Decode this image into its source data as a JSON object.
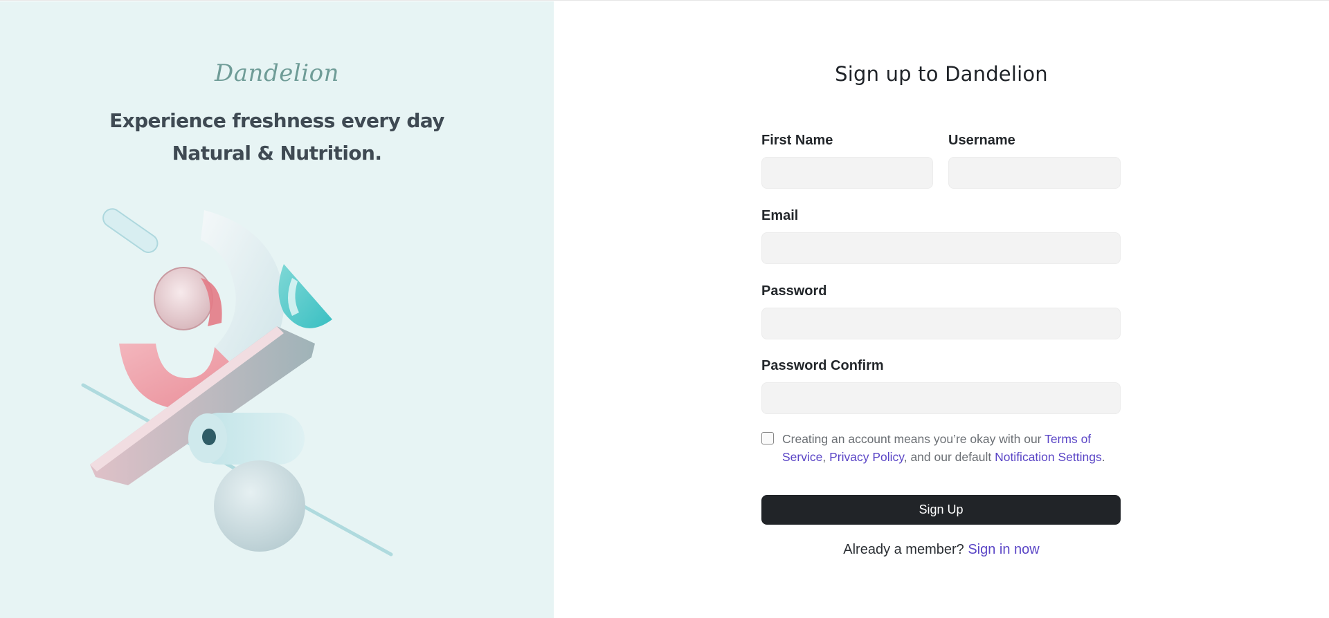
{
  "brand": {
    "name": "Dandelion",
    "tagline_line1": "Experience freshness every day",
    "tagline_line2": "Natural & Nutrition."
  },
  "form": {
    "title": "Sign up to Dandelion",
    "first_name_label": "First Name",
    "username_label": "Username",
    "email_label": "Email",
    "password_label": "Password",
    "password_confirm_label": "Password Confirm",
    "first_name_value": "",
    "username_value": "",
    "email_value": "",
    "password_value": "",
    "password_confirm_value": ""
  },
  "terms": {
    "prefix": "Creating an account means you’re okay with our ",
    "terms_link": "Terms of Service",
    "comma": ", ",
    "privacy_link": "Privacy Policy",
    "middle": ", and our default ",
    "notification_link": "Notification Settings",
    "suffix": ".",
    "checked": false
  },
  "actions": {
    "signup_label": "Sign Up",
    "already_member": "Already a member?",
    "signin_link": "Sign in now"
  },
  "colors": {
    "left_bg": "#e7f4f4",
    "brand_text": "#6f9c97",
    "link": "#5a45c6",
    "button_bg": "#212428",
    "input_bg": "#f3f3f3"
  },
  "illustration": "3d-abstract-shapes"
}
